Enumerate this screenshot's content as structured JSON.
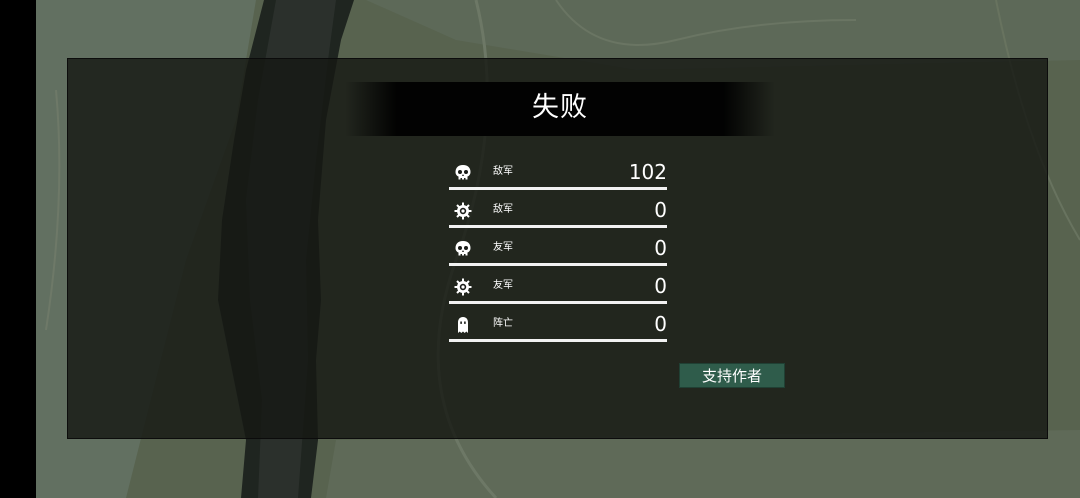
{
  "result": {
    "title": "失败"
  },
  "stats": [
    {
      "icon": "skull-icon",
      "label": "敌军",
      "value": "102"
    },
    {
      "icon": "gear-icon",
      "label": "敌军",
      "value": "0"
    },
    {
      "icon": "skull-icon",
      "label": "友军",
      "value": "0"
    },
    {
      "icon": "gear-icon",
      "label": "友军",
      "value": "0"
    },
    {
      "icon": "ghost-icon",
      "label": "阵亡",
      "value": "0"
    }
  ],
  "actions": {
    "support_label": "支持作者"
  },
  "colors": {
    "panel": "#161814",
    "button": "#2f5c4b",
    "text": "#ffffff",
    "map": "#56614f"
  }
}
